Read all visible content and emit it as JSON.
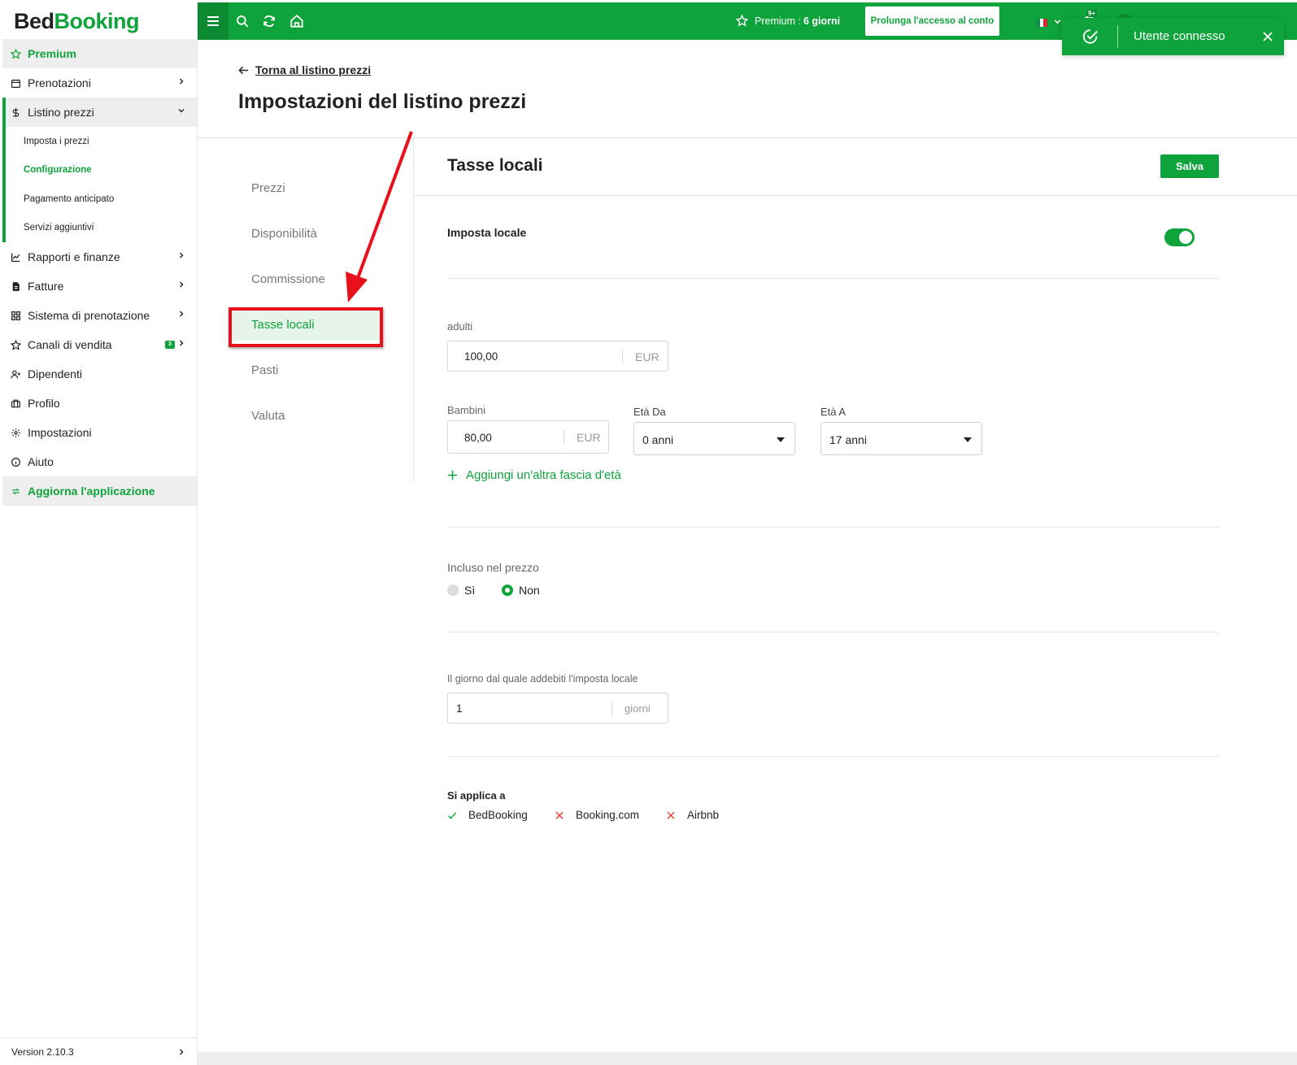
{
  "brand": {
    "part1": "Bed",
    "part2": "Booking",
    "green": "#0fa33b"
  },
  "sidebar": {
    "premium": "Premium",
    "items": [
      {
        "label": "Prenotazioni",
        "icon": "calendar-icon"
      },
      {
        "label": "Listino prezzi",
        "icon": "dollar-icon"
      },
      {
        "label": "Rapporti e finanze",
        "icon": "chart-icon"
      },
      {
        "label": "Fatture",
        "icon": "invoice-icon"
      },
      {
        "label": "Sistema di prenotazione",
        "icon": "grid-icon"
      },
      {
        "label": "Canali di vendita",
        "icon": "star-icon",
        "badge": "3"
      },
      {
        "label": "Dipendenti",
        "icon": "user-add-icon"
      },
      {
        "label": "Profilo",
        "icon": "briefcase-icon"
      },
      {
        "label": "Impostazioni",
        "icon": "gear-icon"
      },
      {
        "label": "Aiuto",
        "icon": "info-icon"
      }
    ],
    "subitems": [
      "Imposta i prezzi",
      "Configurazione",
      "Pagamento anticipato",
      "Servizi aggiuntivi"
    ],
    "update": "Aggiorna l'applicazione",
    "version": "Version 2.10.3"
  },
  "topbar": {
    "premium_label": "Premium :",
    "premium_days": "6 giorni",
    "extend_button": "Prolunga l'accesso al conto",
    "notif_badge": "9+"
  },
  "toast": {
    "message": "Utente connesso"
  },
  "header": {
    "back_link": "Torna al listino prezzi",
    "title": "Impostazioni del listino prezzi"
  },
  "settings_menu": [
    "Prezzi",
    "Disponibilità",
    "Commissione",
    "Tasse locali",
    "Pasti",
    "Valuta"
  ],
  "form": {
    "section_title": "Tasse locali",
    "save_button": "Salva",
    "tax_label": "Imposta locale",
    "tax_enabled": true,
    "adults_label": "adulti",
    "adults_value": "100,00",
    "currency": "EUR",
    "children_label": "Bambini",
    "children_value": "80,00",
    "age_from_label": "Età Da",
    "age_from_value": "0 anni",
    "age_to_label": "Età A",
    "age_to_value": "17 anni",
    "add_range": "Aggiungi un'altra fascia d'età",
    "included_label": "Incluso nel prezzo",
    "included_yes": "Sì",
    "included_no": "Non",
    "included_selected": "Non",
    "day_label": "Il giorno dal quale addebiti l'imposta locale",
    "day_value": "1",
    "day_unit": "giorni",
    "applies_label": "Si applica a",
    "channels": [
      {
        "name": "BedBooking",
        "enabled": true
      },
      {
        "name": "Booking.com",
        "enabled": false
      },
      {
        "name": "Airbnb",
        "enabled": false
      }
    ]
  }
}
